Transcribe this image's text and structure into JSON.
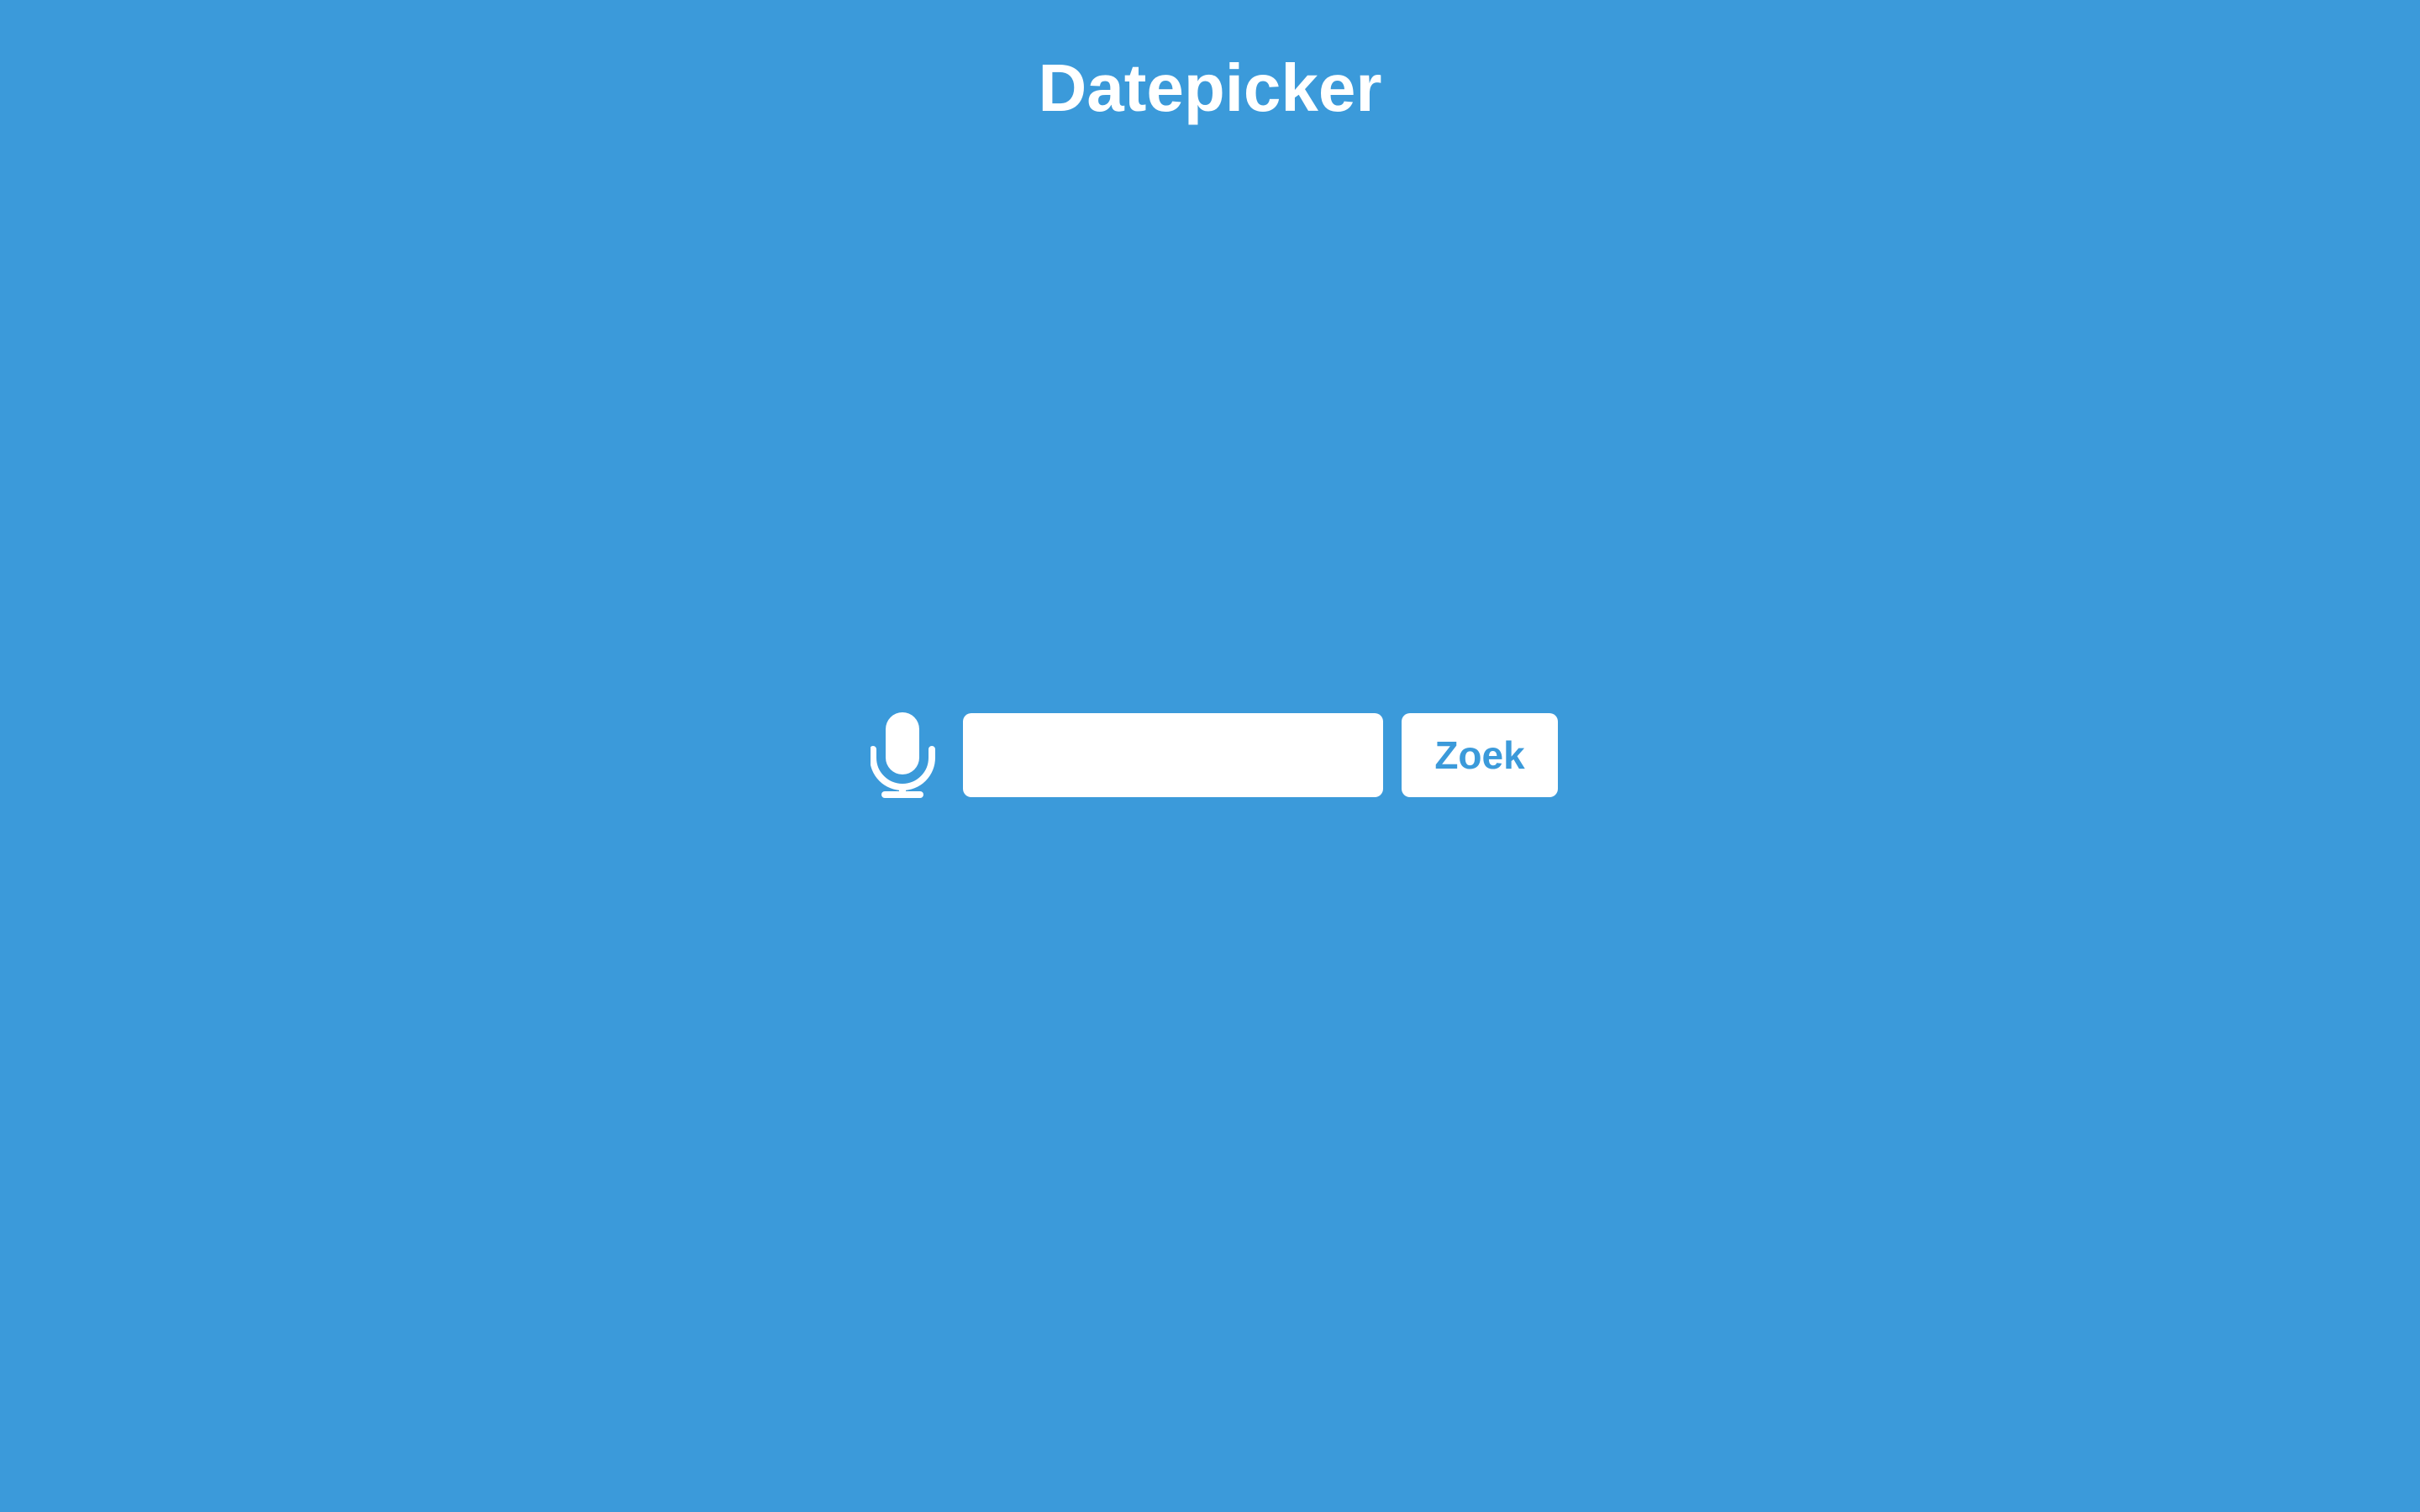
{
  "header": {
    "title": "Datepicker"
  },
  "search": {
    "value": "",
    "placeholder": "",
    "button_label": "Zoek",
    "voice_icon": "microphone-icon"
  },
  "colors": {
    "background": "#3b9ada",
    "foreground": "#ffffff",
    "accent_text": "#3b9ada"
  }
}
